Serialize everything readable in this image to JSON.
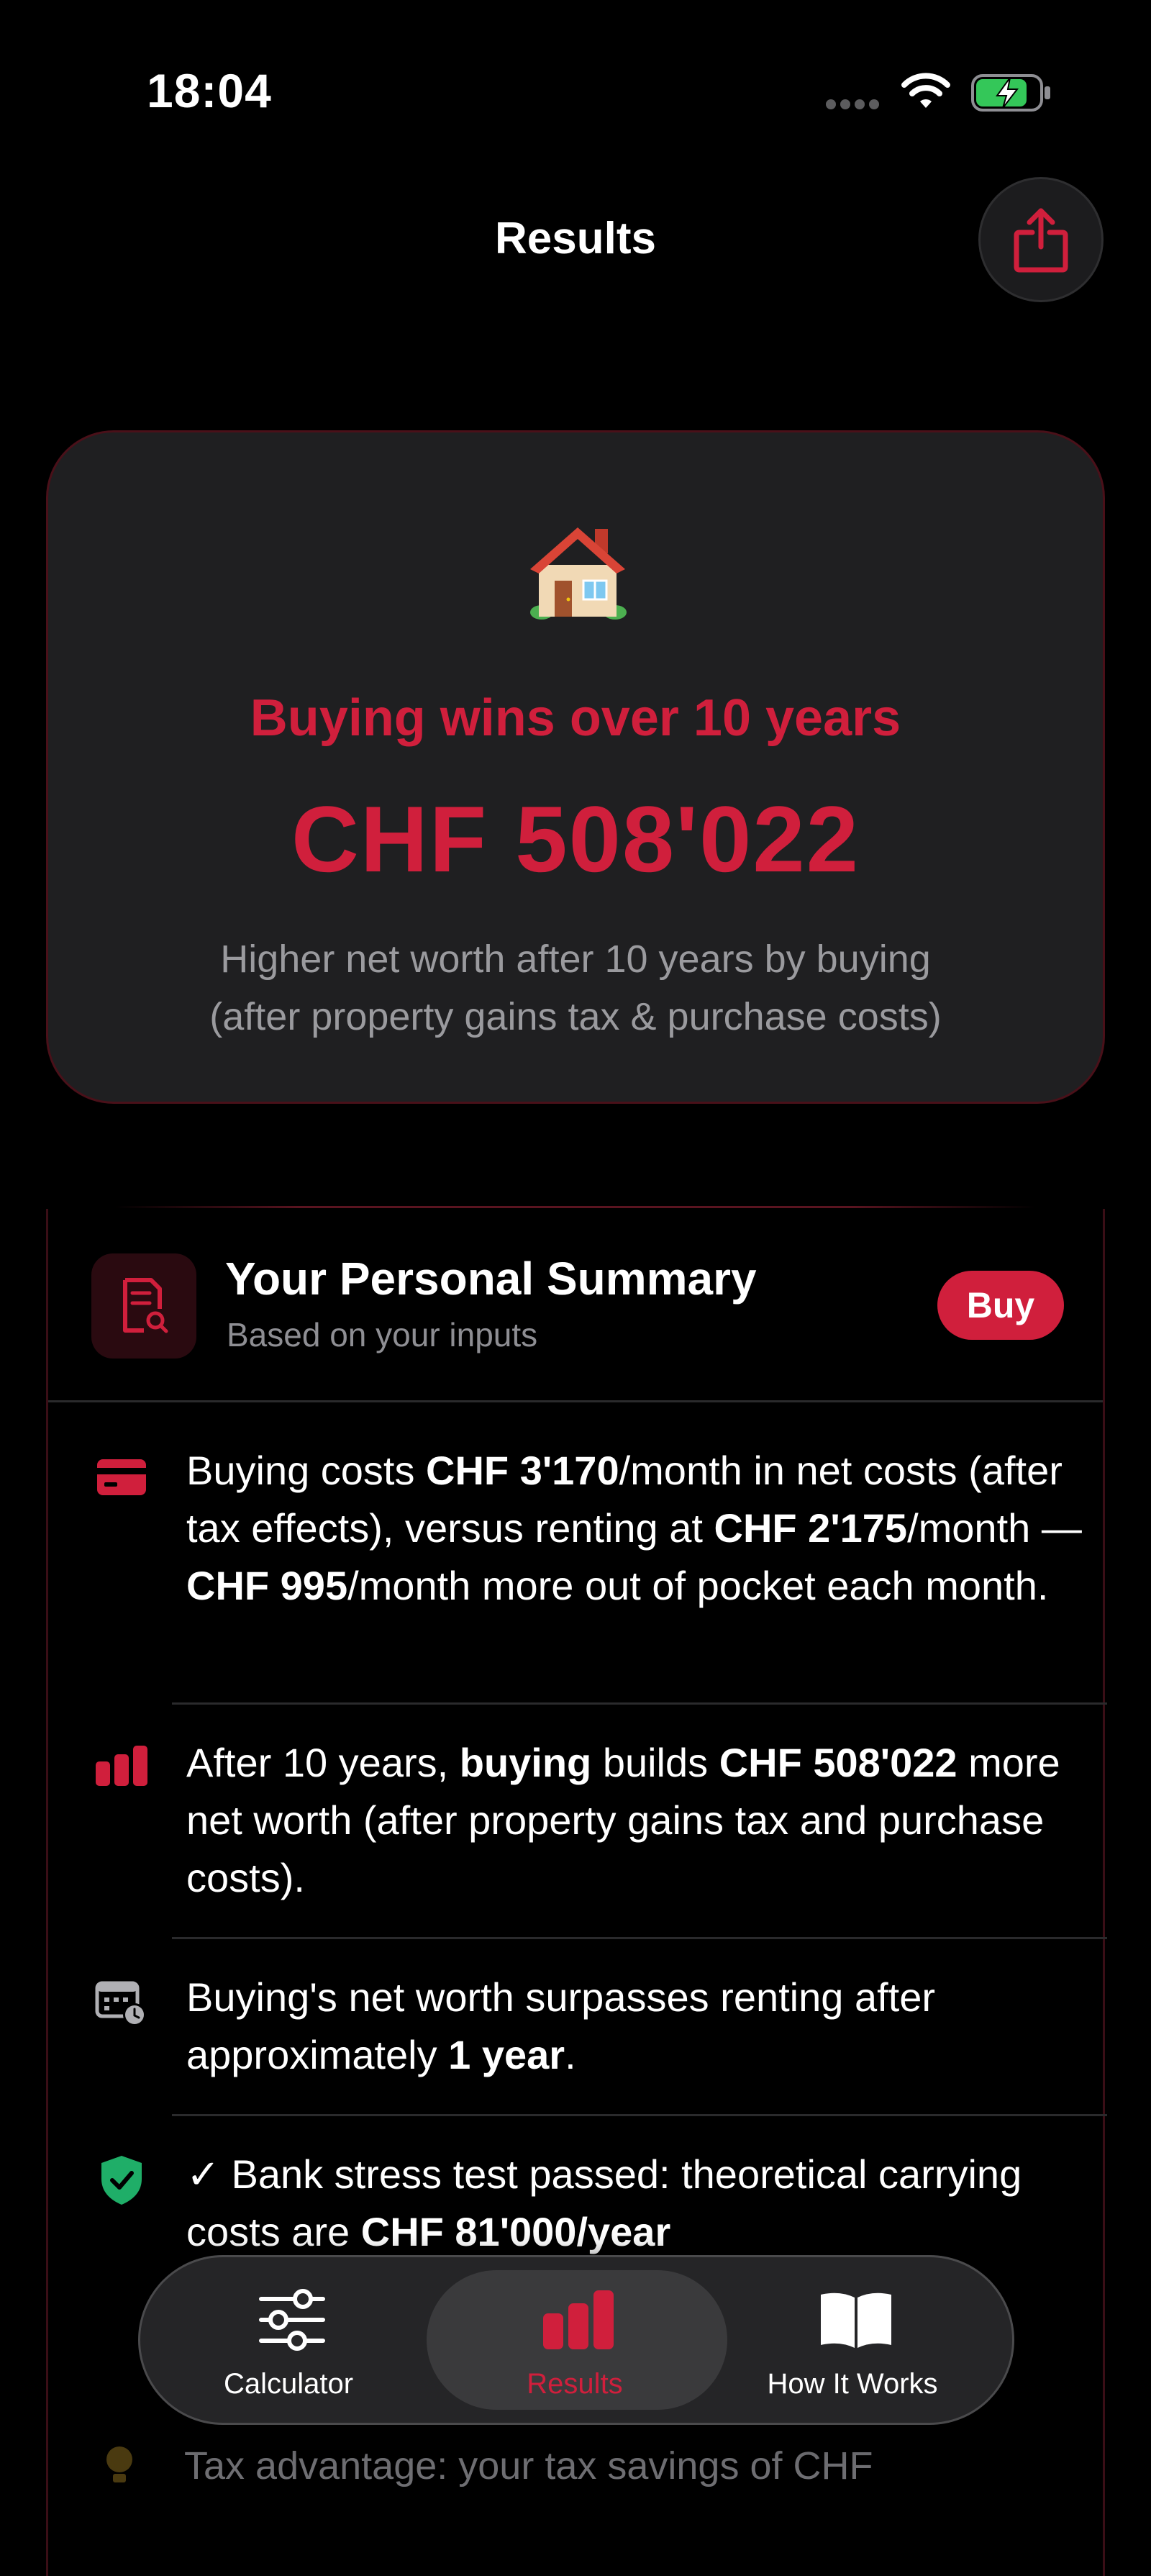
{
  "status_bar": {
    "time": "18:04"
  },
  "nav": {
    "title": "Results"
  },
  "hero": {
    "headline": "Buying wins over 10 years",
    "amount": "CHF 508'022",
    "subtitle_line1": "Higher net worth after 10 years by buying",
    "subtitle_line2": "(after property gains tax & purchase costs)"
  },
  "summary": {
    "title": "Your Personal Summary",
    "subtitle": "Based on your inputs",
    "badge": "Buy",
    "insights": [
      {
        "icon": "credit-card-icon",
        "parts": [
          "Buying costs ",
          "CHF 3'170",
          "/month in net costs (after tax effects), versus renting at ",
          "CHF 2'175",
          "/month — ",
          "CHF 995",
          "/month more out of pocket each month."
        ]
      },
      {
        "icon": "bar-chart-icon",
        "parts": [
          "After 10 years, ",
          "buying",
          " builds ",
          "CHF 508'022",
          " more net worth (after property gains tax and purchase costs)."
        ]
      },
      {
        "icon": "calendar-clock-icon",
        "parts": [
          "Buying's net worth surpasses renting after approximately ",
          "1 year",
          "."
        ]
      },
      {
        "icon": "shield-check-icon",
        "parts": [
          "✓ Bank stress test passed: theoretical carrying costs are ",
          "CHF 81'000/year",
          ""
        ]
      }
    ],
    "faded_text": "Tax advantage: your tax savings of CHF"
  },
  "tab_bar": {
    "tabs": [
      {
        "label": "Calculator",
        "icon": "sliders-icon"
      },
      {
        "label": "Results",
        "icon": "bar-chart-icon"
      },
      {
        "label": "How It Works",
        "icon": "book-icon"
      }
    ],
    "active": "Results"
  },
  "colors": {
    "accent": "#d01f3c",
    "background": "#000000",
    "card": "#1f1f21",
    "secondary_text": "#9a9a9e",
    "success": "#1fae68"
  }
}
